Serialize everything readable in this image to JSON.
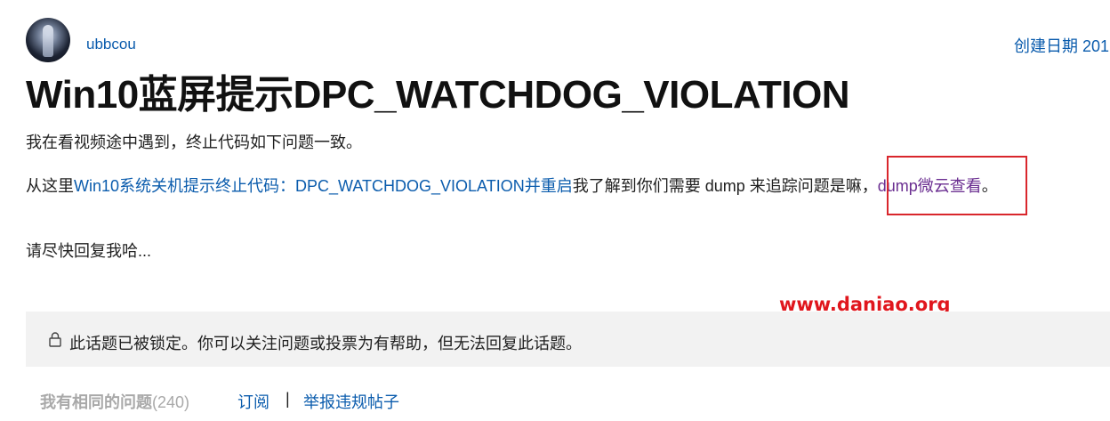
{
  "author": {
    "username": "ubbcou"
  },
  "meta": {
    "created_date_label": "创建日期 201"
  },
  "post": {
    "title": "Win10蓝屏提示DPC_WATCHDOG_VIOLATION",
    "line1": "我在看视频途中遇到，终止代码如下问题一致。",
    "line2_prefix": "从这里",
    "line2_link": "Win10系统关机提示终止代码：DPC_WATCHDOG_VIOLATION并重启",
    "line2_middle": "我了解到你们需要 dump 来追踪问题是嘛，",
    "line2_link2": "dump微云查看",
    "line2_suffix": "。",
    "line3": "请尽快回复我哈..."
  },
  "watermark": "www.daniao.org",
  "locked_notice": {
    "icon": "lock-icon",
    "text": "此话题已被锁定。你可以关注问题或投票为有帮助，但无法回复此话题。"
  },
  "actions": {
    "same_question_label": "我有相同的问题",
    "same_question_count": "(240)",
    "subscribe_label": "订阅",
    "divider": "|",
    "report_label": "举报违规帖子"
  },
  "colors": {
    "link": "#0b5cad",
    "visited_link": "#6b2f91",
    "highlight_border": "#d9262c",
    "watermark": "#e0161d",
    "locked_bg": "#f2f2f2"
  }
}
